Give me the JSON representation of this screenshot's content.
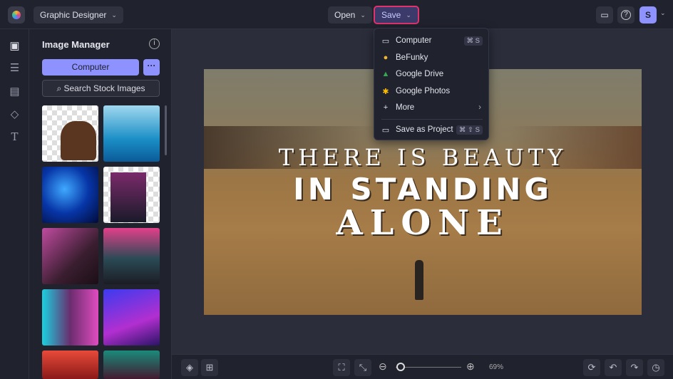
{
  "topbar": {
    "project": "Graphic Designer",
    "open": "Open",
    "save": "Save",
    "avatar": "S"
  },
  "panel": {
    "title": "Image Manager",
    "computer": "Computer",
    "more": "···",
    "search": "Search Stock Images"
  },
  "canvas": {
    "line1": "THERE IS BEAUTY",
    "line2": "IN STANDING",
    "line3": "ALONE"
  },
  "save_menu": {
    "items": [
      {
        "label": "Computer",
        "shortcut": "⌘ S",
        "icon": "monitor-icon"
      },
      {
        "label": "BeFunky",
        "icon": "befunky-icon"
      },
      {
        "label": "Google Drive",
        "icon": "google-drive-icon"
      },
      {
        "label": "Google Photos",
        "icon": "google-photos-icon"
      },
      {
        "label": "More",
        "icon": "plus-icon"
      },
      {
        "label": "Save as Project",
        "shortcut": "⌘ ⇧ S",
        "icon": "folder-icon"
      }
    ]
  },
  "bottombar": {
    "zoom": "69%",
    "zoom_fraction": 0.08
  },
  "colors": {
    "accent": "#8e92ff",
    "save_highlight": "#e0336e"
  }
}
